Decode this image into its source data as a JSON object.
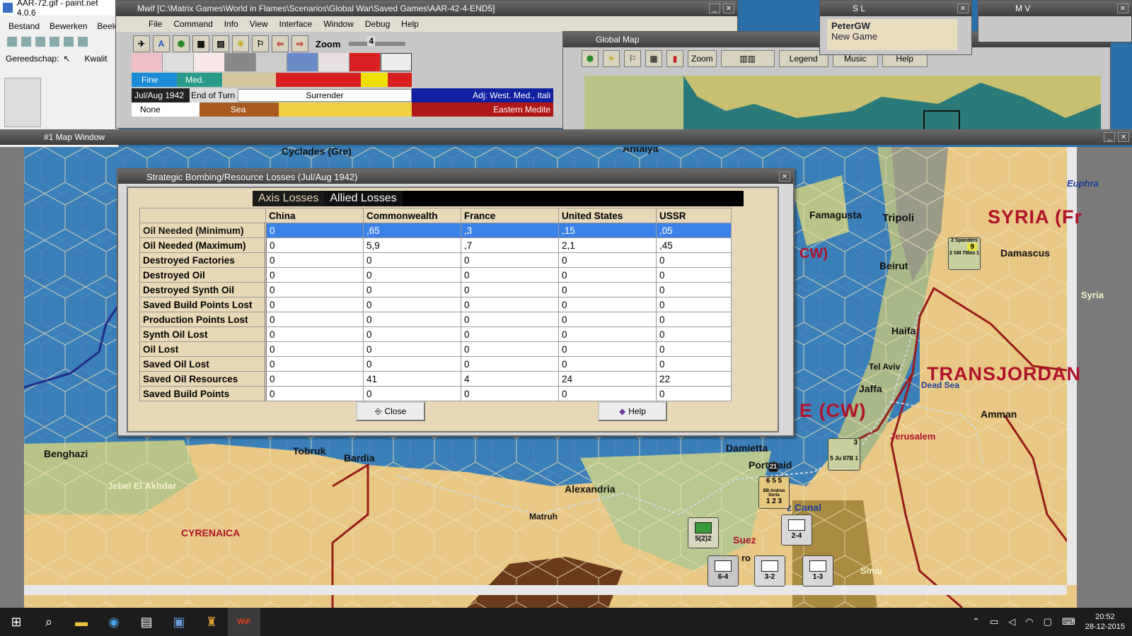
{
  "paintnet": {
    "title": "AAR-72.gif - paint.net 4.0.6",
    "menu": [
      "Bestand",
      "Bewerken",
      "Beeld"
    ],
    "tool_label": "Gereedschap:",
    "quality_label": "Kwalit"
  },
  "mwif": {
    "title": "Mwif [C:\\Matrix Games\\World in Flames\\Scenarios\\Global War\\Saved Games\\AAR-42-4-END5]",
    "menu": [
      "File",
      "Command",
      "Info",
      "View",
      "Interface",
      "Window",
      "Debug",
      "Help"
    ],
    "zoom_label": "Zoom",
    "zoom_value": "4",
    "weather": "Fine",
    "sea_zone_short": "Med.",
    "date": "Jul/Aug 1942",
    "phase": "End of Turn",
    "surrender_label": "Surrender",
    "adjacent": "Adj: West. Med., Itali",
    "terrain": "None",
    "terrain_type": "Sea",
    "region": "Eastern Medite"
  },
  "global_map": {
    "title": "Global Map",
    "zoom_label": "Zoom",
    "legend_label": "Legend",
    "music_label": "Music",
    "help_label": "Help"
  },
  "sl_window": {
    "title": "S L",
    "player": "PeterGW",
    "status": "New Game"
  },
  "mv_window": {
    "title": "M V"
  },
  "map_window": {
    "title": "#1 Map Window"
  },
  "dialog": {
    "title": "Strategic Bombing/Resource Losses (Jul/Aug 1942)",
    "tabs": [
      "Axis Losses",
      "Allied Losses"
    ],
    "columns": [
      "",
      "China",
      "Commonwealth",
      "France",
      "United States",
      "USSR"
    ],
    "rows": [
      [
        "Oil Needed (Minimum)",
        "0",
        ",65",
        ",3",
        ",15",
        ",05"
      ],
      [
        "Oil Needed (Maximum)",
        "0",
        "5,9",
        ",7",
        "2,1",
        ",45"
      ],
      [
        "Destroyed Factories",
        "0",
        "0",
        "0",
        "0",
        "0"
      ],
      [
        "Destroyed Oil",
        "0",
        "0",
        "0",
        "0",
        "0"
      ],
      [
        "Destroyed Synth Oil",
        "0",
        "0",
        "0",
        "0",
        "0"
      ],
      [
        "Saved Build Points Lost",
        "0",
        "0",
        "0",
        "0",
        "0"
      ],
      [
        "Production Points Lost",
        "0",
        "0",
        "0",
        "0",
        "0"
      ],
      [
        "Synth Oil Lost",
        "0",
        "0",
        "0",
        "0",
        "0"
      ],
      [
        "Oil Lost",
        "0",
        "0",
        "0",
        "0",
        "0"
      ],
      [
        "Saved Oil Lost",
        "0",
        "0",
        "0",
        "0",
        "0"
      ],
      [
        "Saved Oil Resources",
        "0",
        "41",
        "4",
        "24",
        "22"
      ],
      [
        "Saved Build Points",
        "0",
        "0",
        "0",
        "0",
        "0"
      ]
    ],
    "close_label": "Close",
    "help_label": "Help"
  },
  "map_labels": {
    "cyclades": "Cyclades (Gre)",
    "antalya": "Antalya",
    "famagusta": "Famagusta",
    "tripoli": "Tripoli",
    "syria": "SYRIA (Fr",
    "damascus": "Damascus",
    "beirut": "Beirut",
    "haifa": "Haifa",
    "tel_aviv": "Tel Aviv",
    "jaffa": "Jaffa",
    "dead_sea": "Dead Sea",
    "transjordan": "TRANSJORDAN",
    "amman": "Amman",
    "jerusalem": "Jerusalem",
    "cw_egypt": "E (CW)",
    "cw_cyprus": "CW)",
    "euphrates": "Euphra",
    "syria_small": "Syria",
    "benghazi": "Benghazi",
    "tobruk": "Tobruk",
    "bardia": "Bardia",
    "jebel": "Jebel El Akhdar",
    "cyrenaica": "CYRENAICA",
    "damietta": "Damietta",
    "port_said": "Port Said",
    "alexandria": "Alexandria",
    "matruh": "Matruh",
    "suez_canal": "z Canal",
    "suez": "Suez",
    "sinai": "Sinai",
    "cairo_frag": "ro"
  },
  "counters": {
    "stuka": "5 Ju 87B 1",
    "stuka_top": "3",
    "air_syria_a": "2 Spanders",
    "air_syria_b": "2 SM 79bis 1",
    "air_syria_val": "9",
    "infantry_green": "5(2)2",
    "ship_label": "BB Andrea Doria",
    "ship_top": "6 5 5",
    "ship_bottom": "1 2 3",
    "corps_a": "2-4",
    "corps_b": "6-4",
    "corps_c": "3-2",
    "corps_d": "1-3",
    "stack_marker": "21"
  },
  "taskbar": {
    "time": "20:52",
    "date": "28-12-2015"
  },
  "colors": {
    "sea": "#3b7fb8",
    "desert": "#e8c884",
    "border_red": "#9a1a1a",
    "dialog_bg": "#e8d8b8",
    "selected_row": "#3b82e8"
  }
}
